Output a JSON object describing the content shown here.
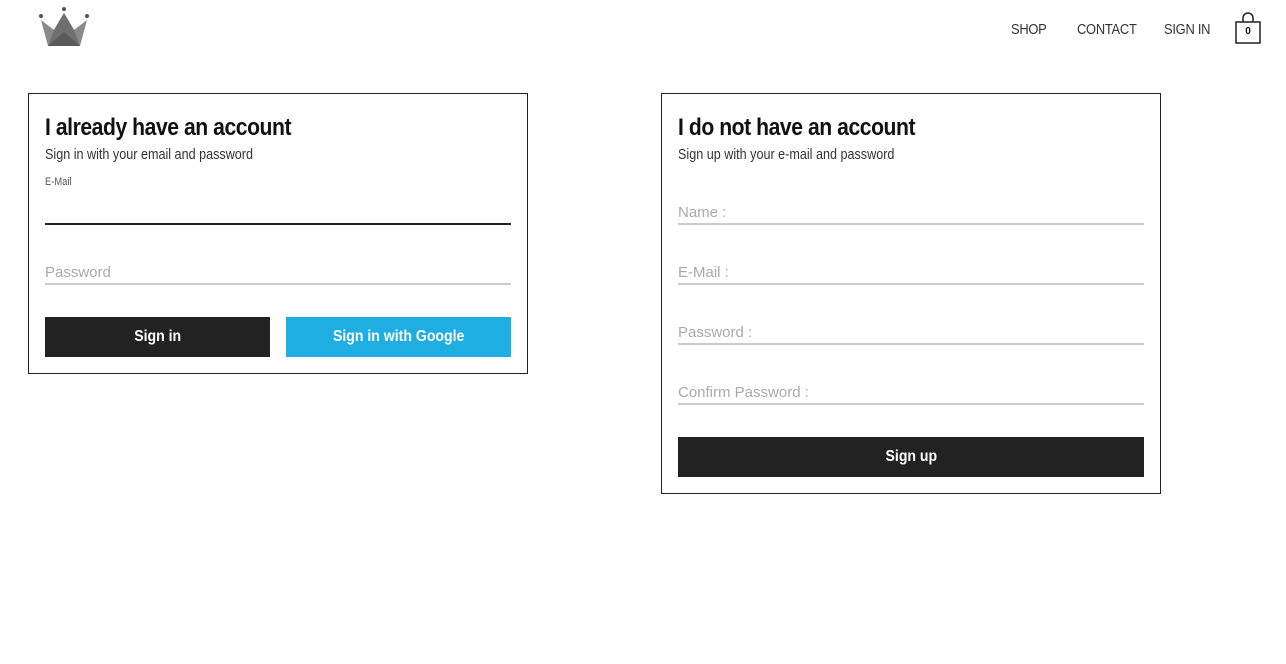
{
  "header": {
    "logo_icon": "crown-icon",
    "nav": {
      "shop": "SHOP",
      "contact": "CONTACT",
      "signin": "SIGN IN"
    },
    "cart": {
      "icon": "shopping-bag-icon",
      "count": "0"
    }
  },
  "signin_panel": {
    "title": "I already have an account",
    "subtitle": "Sign in with your email and password",
    "email_label": "E-Mail",
    "email_value": "",
    "password_placeholder": "Password",
    "signin_button": "Sign in",
    "google_button": "Sign in with Google"
  },
  "signup_panel": {
    "title": "I do not have an account",
    "subtitle": "Sign up with your e-mail and password",
    "name_placeholder": "Name :",
    "email_placeholder": "E-Mail :",
    "password_placeholder": "Password :",
    "confirm_placeholder": "Confirm Password :",
    "signup_button": "Sign up"
  },
  "colors": {
    "dark_button": "#222222",
    "google_button": "#1eaee2",
    "border": "#222222",
    "underline": "#cccccc"
  }
}
